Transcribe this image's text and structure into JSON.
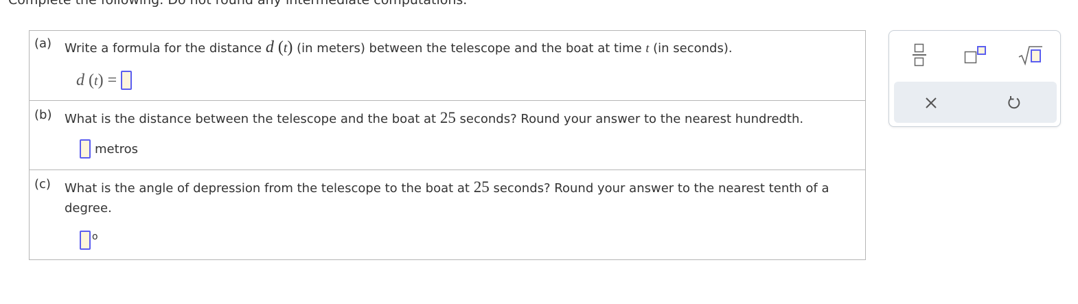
{
  "instructions": "Complete the following. Do not round any intermediate computations.",
  "parts": {
    "a": {
      "letter": "(a)",
      "question_before": "Write a formula for the distance ",
      "func_d": "d",
      "func_t": "t",
      "question_mid1": " (in meters) between the telescope and the boat at time ",
      "var_t": "t",
      "question_end": " (in seconds).",
      "formula_lhs_d": "d",
      "formula_lhs_t": "t",
      "formula_equals": "="
    },
    "b": {
      "letter": "(b)",
      "question_before": "What is the distance between the telescope and the boat at ",
      "number": "25",
      "question_after": " seconds? Round your answer to the nearest hundredth.",
      "unit": "metros"
    },
    "c": {
      "letter": "(c)",
      "question_before": "What is the angle of depression from the telescope to the boat at ",
      "number": "25",
      "question_after": " seconds? Round your answer to the nearest tenth of a degree.",
      "unit_symbol": "o"
    }
  },
  "toolbox": {
    "tools": [
      "fraction-icon",
      "superscript-icon",
      "square-root-icon"
    ],
    "actions": [
      "clear-icon",
      "undo-icon"
    ],
    "accent_color": "#5a5df0",
    "input_fill": "#fdf5dc"
  }
}
